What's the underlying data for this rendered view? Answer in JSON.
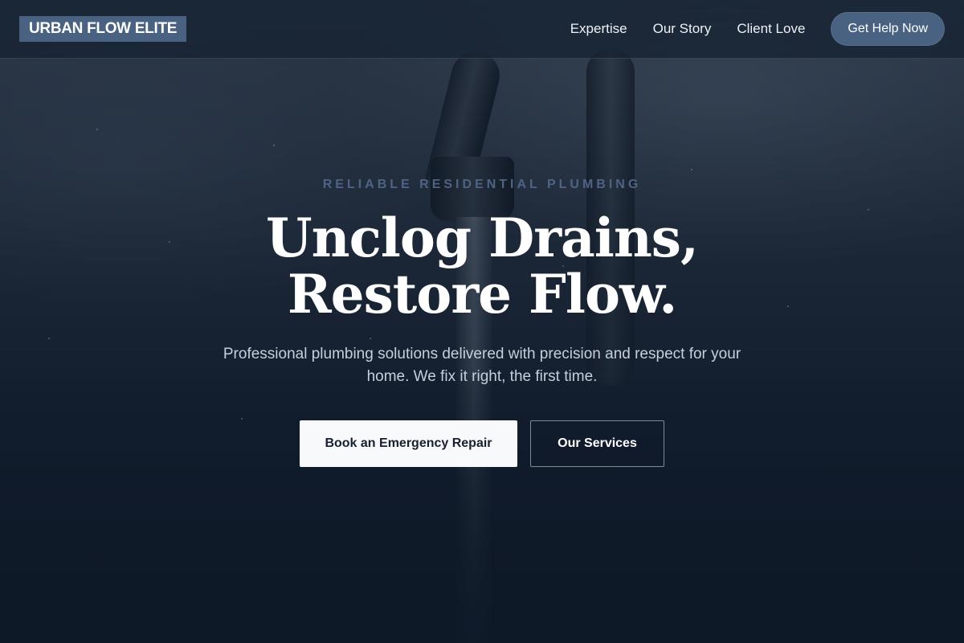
{
  "header": {
    "logo": "URBAN FLOW ELITE",
    "nav": [
      {
        "label": "Expertise"
      },
      {
        "label": "Our Story"
      },
      {
        "label": "Client Love"
      }
    ],
    "cta_label": "Get Help Now"
  },
  "hero": {
    "eyebrow": "RELIABLE RESIDENTIAL PLUMBING",
    "headline_line1": "Unclog Drains,",
    "headline_line2": "Restore Flow.",
    "subtext": "Professional plumbing solutions delivered with precision and respect for your home. We fix it right, the first time.",
    "primary_button": "Book an Emergency Repair",
    "secondary_button": "Our Services"
  },
  "colors": {
    "brand": "#4a6282",
    "background": "#0f1a2a",
    "eyebrow": "#4f6384",
    "primary_button_bg": "#f7f9fb"
  }
}
